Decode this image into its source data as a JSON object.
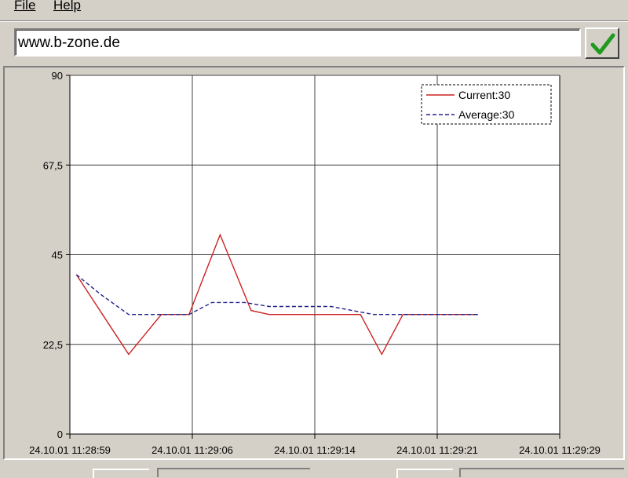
{
  "menu": {
    "file": "File",
    "help": "Help"
  },
  "address": {
    "value": "www.b-zone.de"
  },
  "go_button": {
    "icon": "checkmark-icon",
    "color": "#1f9a1f"
  },
  "chart_data": {
    "type": "line",
    "title": "",
    "xlabel": "",
    "ylabel": "",
    "ylim": [
      0,
      90
    ],
    "y_ticks": [
      "0",
      "22,5",
      "45",
      "67,5",
      "90"
    ],
    "y_tick_values": [
      0,
      22.5,
      45,
      67.5,
      90
    ],
    "x_ticks": [
      "24.10.01 11:28:59",
      "24.10.01 11:29:06",
      "24.10.01 11:29:14",
      "24.10.01 11:29:21",
      "24.10.01 11:29:29"
    ],
    "x_range": [
      0,
      30
    ],
    "grid": true,
    "legend_placement": "top-right",
    "series": [
      {
        "name": "Current:30",
        "color": "#cc2222",
        "style": "solid",
        "x": [
          0.4,
          3.6,
          5.6,
          7.3,
          9.2,
          11.1,
          12.2,
          17.8,
          19.1,
          20.4,
          25.0
        ],
        "y": [
          40,
          20,
          30,
          30,
          50,
          31,
          30,
          30,
          20,
          30,
          30
        ]
      },
      {
        "name": "Average:30",
        "color": "#22228c",
        "style": "dashed",
        "x": [
          0.4,
          1.9,
          3.6,
          5.6,
          7.3,
          8.7,
          10.7,
          12.2,
          16.0,
          18.6,
          20.4,
          25.0
        ],
        "y": [
          40,
          35,
          30,
          30,
          30,
          33,
          33,
          32,
          32,
          30,
          30,
          30
        ]
      }
    ]
  }
}
